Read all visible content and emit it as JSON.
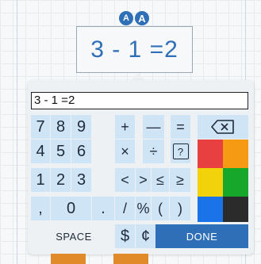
{
  "font_toggle": {
    "small": "A",
    "large": "A"
  },
  "expression": {
    "display": "3 - 1 =2"
  },
  "input": {
    "value": "3 - 1 =2"
  },
  "keys": {
    "row1": [
      "7",
      "8",
      "9",
      "+",
      "—",
      "="
    ],
    "row2": [
      "4",
      "5",
      "6",
      "×",
      "÷",
      "?"
    ],
    "row3": [
      "1",
      "2",
      "3",
      "<",
      ">",
      "≤",
      "≥"
    ],
    "row4": [
      ",",
      "0",
      ".",
      "/",
      "%",
      "(",
      ")"
    ],
    "space": "SPACE",
    "dollar": "$",
    "cent": "¢",
    "done": "DONE"
  },
  "colors": {
    "red": "#e84040",
    "orange": "#f59a12",
    "yellow": "#f2d20a",
    "green": "#17a82b",
    "blue": "#1a73e8",
    "black": "#2b2b2b",
    "accent": "#2f6fb7"
  },
  "icons": {
    "backspace": "backspace-icon"
  }
}
